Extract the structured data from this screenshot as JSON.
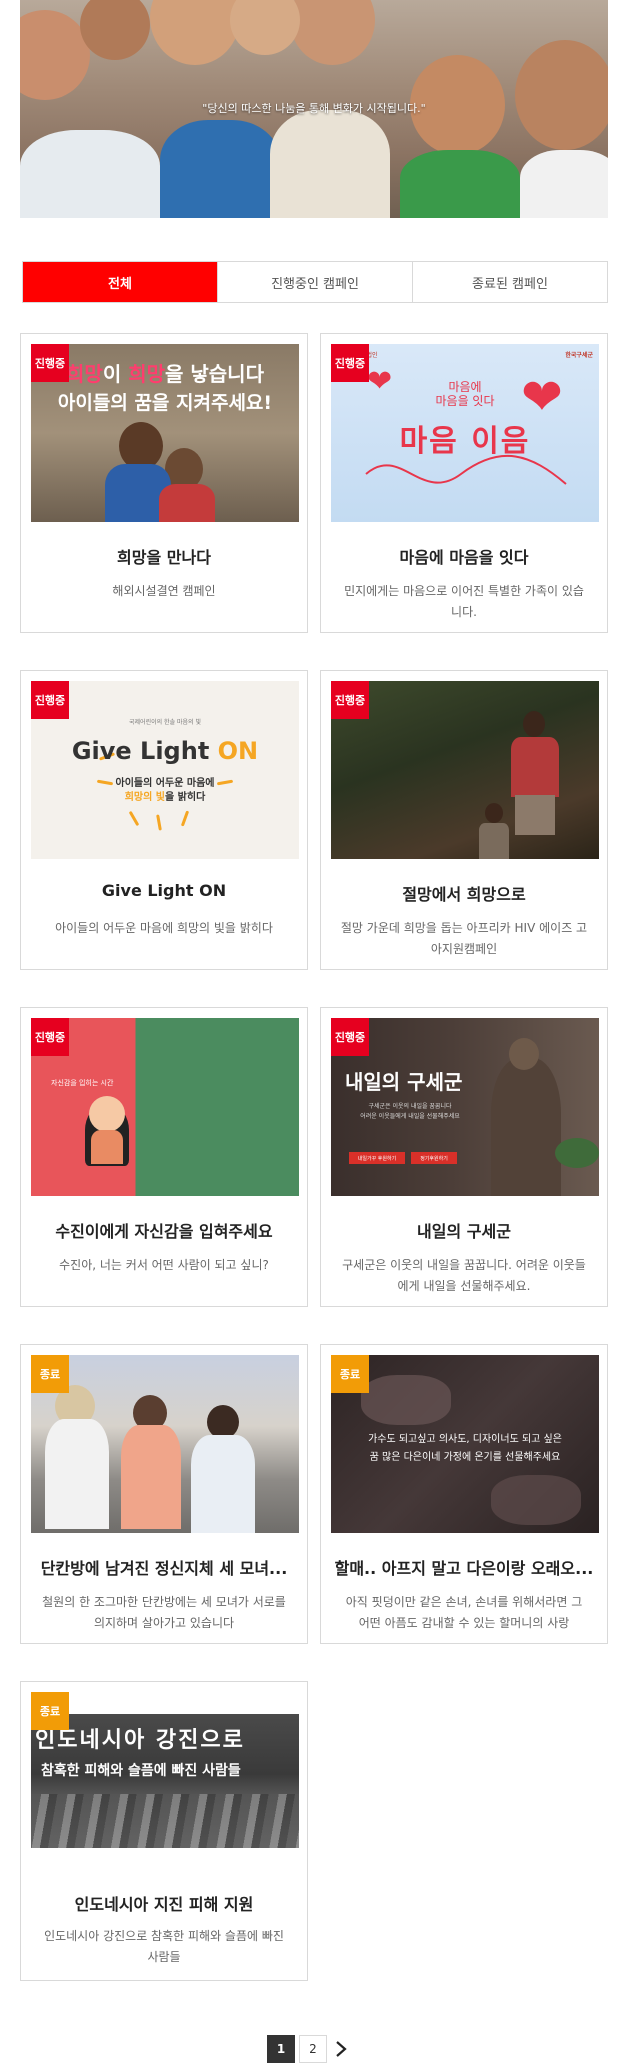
{
  "hero": {
    "quote": "\"당신의 따스한 나눔을 통해 변화가 시작됩니다.\""
  },
  "tabs": [
    {
      "label": "전체",
      "active": true
    },
    {
      "label": "진행중인 캠페인",
      "active": false
    },
    {
      "label": "종료된 캠페인",
      "active": false
    }
  ],
  "cards": [
    {
      "badge": "진행중",
      "title": "희망을 만나다",
      "desc": "해외시설결연 캠페인",
      "thumb": {
        "hl1": "희망",
        "mid": "이 ",
        "hl2": "희망",
        "tail": "을 낳습니다",
        "line2": "아이들의 꿈을 지켜주세요!"
      }
    },
    {
      "badge": "진행중",
      "title": "마음에 마음을 잇다",
      "desc": "민지에게는 마음으로 이어진 특별한 가족이 있습니다.",
      "thumb": {
        "corner_left": "기독교한 방법인",
        "corner_right": "한국구세군",
        "small": "마음에\n마음을 잇다",
        "big": "마음 이음"
      }
    },
    {
      "badge": "진행중",
      "title": "Give Light ON",
      "desc": "아이들의 어두운 마음에 희망의 빛을 밝히다",
      "thumb": {
        "top": "국제어린이의 한솔 마음의 빛",
        "main_a": "Give Light ",
        "main_b": "ON",
        "sub1": "아이들의 어두운 마음에",
        "sub2a": "희망의 빛",
        "sub2b": "을 밝히다"
      }
    },
    {
      "badge": "진행중",
      "title": "절망에서 희망으로",
      "desc": "절망 가운데 희망을 돕는 아프리카 HIV 에이즈 고아지원캠페인"
    },
    {
      "badge": "진행중",
      "title": "수진이에게 자신감을 입혀주세요",
      "desc": "수진아, 너는 커서 어떤 사람이 되고 싶니?",
      "thumb": {
        "caption": "자신감을 입히는 시간"
      }
    },
    {
      "badge": "진행중",
      "title": "내일의 구세군",
      "desc": "구세군은 이웃의 내일을 꿈꿉니다. 어려운 이웃들에게 내일을 선물해주세요.",
      "thumb": {
        "title": "내일의 구세군",
        "txt": "구세군은 이웃의 내일을 꿈꿉니다\n어려운 이웃들에게 내일을 선물해주세요",
        "btn1": "내일가꾸 후원하기",
        "btn2": "정기후원하기"
      }
    },
    {
      "badge": "종료",
      "title": "단칸방에 남겨진 정신지체 세 모녀...",
      "desc": "철원의 한 조그마한 단칸방에는 세 모녀가 서로를 의지하며 살아가고 있습니다"
    },
    {
      "badge": "종료",
      "title": "할매.. 아프지 말고 다은이랑 오래오...",
      "desc": "아직 핏덩이만 같은 손녀, 손녀를 위해서라면 그 어떤 아픔도 감내할 수 있는 할머니의 사랑",
      "thumb": {
        "txt": "가수도 되고싶고 의사도, 디자이너도 되고 싶은\n꿈 많은 다은이네 가정에 온기를 선물해주세요"
      }
    },
    {
      "badge": "종료",
      "title": "인도네시아 지진 피해 지원",
      "desc": "인도네시아 강진으로 참혹한 피해와 슬픔에 빠진 사람들",
      "thumb": {
        "l1": "인도네시아 강진으로",
        "l2": "참혹한 피해와 슬픔에 빠진 사람들"
      }
    }
  ],
  "pagination": {
    "pages": [
      "1",
      "2"
    ],
    "current": "1",
    "next_icon": "chevron-right-icon"
  },
  "colors": {
    "accent": "#ff0000",
    "ongoing": "#e6001f",
    "ended": "#f29c07"
  }
}
